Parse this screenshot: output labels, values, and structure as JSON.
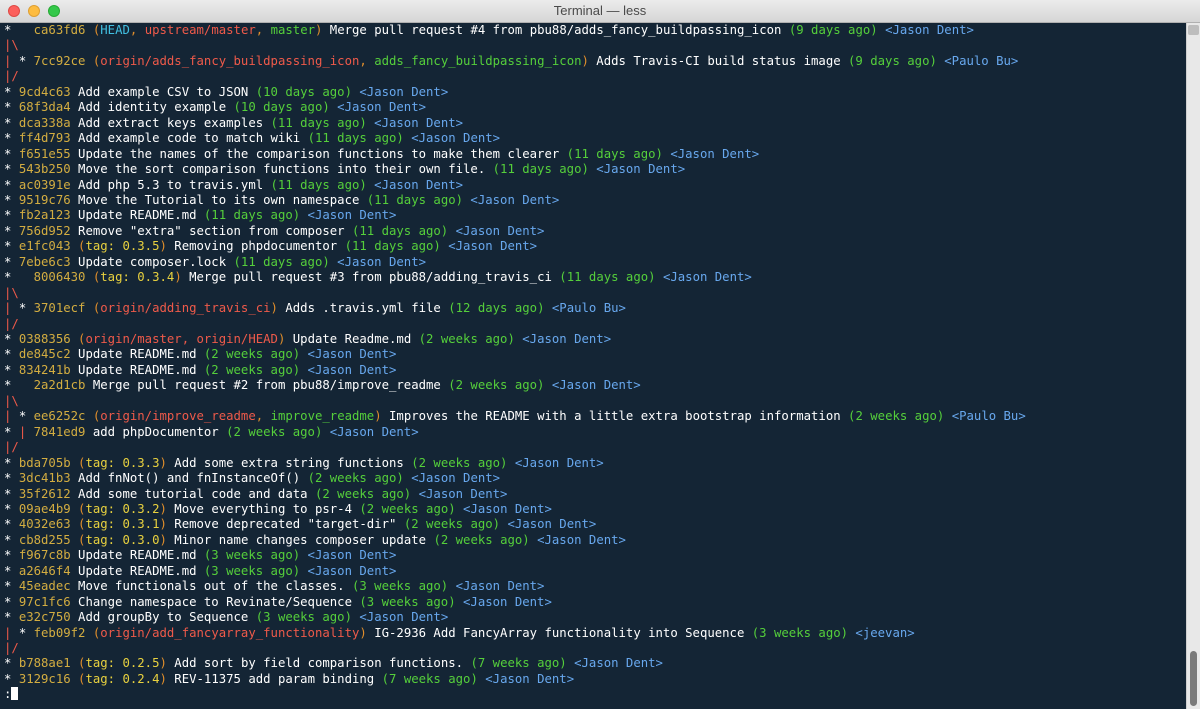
{
  "window": {
    "title": "Terminal — less"
  },
  "colors": {
    "white": "#ffffff",
    "orange": "#e08e2b",
    "gold": "#d3ad41",
    "cyan": "#41bfe0",
    "green": "#55cf3b",
    "blue": "#68a8ee",
    "red": "#ef5a4a",
    "yellow": "#e8d13f",
    "prompt": "#ffffff"
  },
  "prompt": ":",
  "lines": [
    [
      [
        "*",
        "white"
      ],
      [
        "   ",
        "white"
      ],
      [
        "ca63fd6",
        "gold"
      ],
      [
        " (",
        "orange"
      ],
      [
        "HEAD",
        "cyan"
      ],
      [
        ", ",
        "orange"
      ],
      [
        "upstream/master",
        "red"
      ],
      [
        ", ",
        "orange"
      ],
      [
        "master",
        "green"
      ],
      [
        ")",
        "orange"
      ],
      [
        " Merge pull request #4 from pbu88/adds_fancy_buildpassing_icon ",
        "white"
      ],
      [
        "(9 days ago)",
        "green"
      ],
      [
        " <Jason Dent>",
        "blue"
      ]
    ],
    [
      [
        "|\\",
        "red"
      ]
    ],
    [
      [
        "| ",
        "red"
      ],
      [
        "* ",
        "white"
      ],
      [
        "7cc92ce",
        "gold"
      ],
      [
        " (",
        "orange"
      ],
      [
        "origin/adds_fancy_buildpassing_icon",
        "red"
      ],
      [
        ", ",
        "orange"
      ],
      [
        "adds_fancy_buildpassing_icon",
        "green"
      ],
      [
        ")",
        "orange"
      ],
      [
        " Adds Travis-CI build status image ",
        "white"
      ],
      [
        "(9 days ago)",
        "green"
      ],
      [
        " <Paulo Bu>",
        "blue"
      ]
    ],
    [
      [
        "|/",
        "red"
      ]
    ],
    [
      [
        "* ",
        "white"
      ],
      [
        "9cd4c63",
        "gold"
      ],
      [
        " Add example CSV to JSON ",
        "white"
      ],
      [
        "(10 days ago)",
        "green"
      ],
      [
        " <Jason Dent>",
        "blue"
      ]
    ],
    [
      [
        "* ",
        "white"
      ],
      [
        "68f3da4",
        "gold"
      ],
      [
        " Add identity example ",
        "white"
      ],
      [
        "(10 days ago)",
        "green"
      ],
      [
        " <Jason Dent>",
        "blue"
      ]
    ],
    [
      [
        "* ",
        "white"
      ],
      [
        "dca338a",
        "gold"
      ],
      [
        " Add extract keys examples ",
        "white"
      ],
      [
        "(11 days ago)",
        "green"
      ],
      [
        " <Jason Dent>",
        "blue"
      ]
    ],
    [
      [
        "* ",
        "white"
      ],
      [
        "ff4d793",
        "gold"
      ],
      [
        " Add example code to match wiki ",
        "white"
      ],
      [
        "(11 days ago)",
        "green"
      ],
      [
        " <Jason Dent>",
        "blue"
      ]
    ],
    [
      [
        "* ",
        "white"
      ],
      [
        "f651e55",
        "gold"
      ],
      [
        " Update the names of the comparison functions to make them clearer ",
        "white"
      ],
      [
        "(11 days ago)",
        "green"
      ],
      [
        " <Jason Dent>",
        "blue"
      ]
    ],
    [
      [
        "* ",
        "white"
      ],
      [
        "543b250",
        "gold"
      ],
      [
        " Move the sort comparison functions into their own file. ",
        "white"
      ],
      [
        "(11 days ago)",
        "green"
      ],
      [
        " <Jason Dent>",
        "blue"
      ]
    ],
    [
      [
        "* ",
        "white"
      ],
      [
        "ac0391e",
        "gold"
      ],
      [
        " Add php 5.3 to travis.yml ",
        "white"
      ],
      [
        "(11 days ago)",
        "green"
      ],
      [
        " <Jason Dent>",
        "blue"
      ]
    ],
    [
      [
        "* ",
        "white"
      ],
      [
        "9519c76",
        "gold"
      ],
      [
        " Move the Tutorial to its own namespace ",
        "white"
      ],
      [
        "(11 days ago)",
        "green"
      ],
      [
        " <Jason Dent>",
        "blue"
      ]
    ],
    [
      [
        "* ",
        "white"
      ],
      [
        "fb2a123",
        "gold"
      ],
      [
        " Update README.md ",
        "white"
      ],
      [
        "(11 days ago)",
        "green"
      ],
      [
        " <Jason Dent>",
        "blue"
      ]
    ],
    [
      [
        "* ",
        "white"
      ],
      [
        "756d952",
        "gold"
      ],
      [
        " Remove \"extra\" section from composer ",
        "white"
      ],
      [
        "(11 days ago)",
        "green"
      ],
      [
        " <Jason Dent>",
        "blue"
      ]
    ],
    [
      [
        "* ",
        "white"
      ],
      [
        "e1fc043",
        "gold"
      ],
      [
        " (",
        "orange"
      ],
      [
        "tag: 0.3.5",
        "yellow"
      ],
      [
        ")",
        "orange"
      ],
      [
        " Removing phpdocumentor ",
        "white"
      ],
      [
        "(11 days ago)",
        "green"
      ],
      [
        " <Jason Dent>",
        "blue"
      ]
    ],
    [
      [
        "* ",
        "white"
      ],
      [
        "7ebe6c3",
        "gold"
      ],
      [
        " Update composer.lock ",
        "white"
      ],
      [
        "(11 days ago)",
        "green"
      ],
      [
        " <Jason Dent>",
        "blue"
      ]
    ],
    [
      [
        "*",
        "white"
      ],
      [
        "   ",
        "white"
      ],
      [
        "8006430",
        "gold"
      ],
      [
        " (",
        "orange"
      ],
      [
        "tag: 0.3.4",
        "yellow"
      ],
      [
        ")",
        "orange"
      ],
      [
        " Merge pull request #3 from pbu88/adding_travis_ci ",
        "white"
      ],
      [
        "(11 days ago)",
        "green"
      ],
      [
        " <Jason Dent>",
        "blue"
      ]
    ],
    [
      [
        "|\\",
        "red"
      ]
    ],
    [
      [
        "| ",
        "red"
      ],
      [
        "* ",
        "white"
      ],
      [
        "3701ecf",
        "gold"
      ],
      [
        " (",
        "orange"
      ],
      [
        "origin/adding_travis_ci",
        "red"
      ],
      [
        ")",
        "orange"
      ],
      [
        " Adds .travis.yml file ",
        "white"
      ],
      [
        "(12 days ago)",
        "green"
      ],
      [
        " <Paulo Bu>",
        "blue"
      ]
    ],
    [
      [
        "|/",
        "red"
      ]
    ],
    [
      [
        "* ",
        "white"
      ],
      [
        "0388356",
        "gold"
      ],
      [
        " (",
        "orange"
      ],
      [
        "origin/master, origin/HEAD",
        "red"
      ],
      [
        ")",
        "orange"
      ],
      [
        " Update Readme.md ",
        "white"
      ],
      [
        "(2 weeks ago)",
        "green"
      ],
      [
        " <Jason Dent>",
        "blue"
      ]
    ],
    [
      [
        "* ",
        "white"
      ],
      [
        "de845c2",
        "gold"
      ],
      [
        " Update README.md ",
        "white"
      ],
      [
        "(2 weeks ago)",
        "green"
      ],
      [
        " <Jason Dent>",
        "blue"
      ]
    ],
    [
      [
        "* ",
        "white"
      ],
      [
        "834241b",
        "gold"
      ],
      [
        " Update README.md ",
        "white"
      ],
      [
        "(2 weeks ago)",
        "green"
      ],
      [
        " <Jason Dent>",
        "blue"
      ]
    ],
    [
      [
        "*",
        "white"
      ],
      [
        "   ",
        "white"
      ],
      [
        "2a2d1cb",
        "gold"
      ],
      [
        " Merge pull request #2 from pbu88/improve_readme ",
        "white"
      ],
      [
        "(2 weeks ago)",
        "green"
      ],
      [
        " <Jason Dent>",
        "blue"
      ]
    ],
    [
      [
        "|\\",
        "red"
      ]
    ],
    [
      [
        "| ",
        "red"
      ],
      [
        "* ",
        "white"
      ],
      [
        "ee6252c",
        "gold"
      ],
      [
        " (",
        "orange"
      ],
      [
        "origin/improve_readme",
        "red"
      ],
      [
        ", ",
        "orange"
      ],
      [
        "improve_readme",
        "green"
      ],
      [
        ")",
        "orange"
      ],
      [
        " Improves the README with a little extra bootstrap information ",
        "white"
      ],
      [
        "(2 weeks ago)",
        "green"
      ],
      [
        " <Paulo Bu>",
        "blue"
      ]
    ],
    [
      [
        "* ",
        "white"
      ],
      [
        "| ",
        "red"
      ],
      [
        "7841ed9",
        "gold"
      ],
      [
        " add phpDocumentor ",
        "white"
      ],
      [
        "(2 weeks ago)",
        "green"
      ],
      [
        " <Jason Dent>",
        "blue"
      ]
    ],
    [
      [
        "|/",
        "red"
      ]
    ],
    [
      [
        "* ",
        "white"
      ],
      [
        "bda705b",
        "gold"
      ],
      [
        " (",
        "orange"
      ],
      [
        "tag: 0.3.3",
        "yellow"
      ],
      [
        ")",
        "orange"
      ],
      [
        " Add some extra string functions ",
        "white"
      ],
      [
        "(2 weeks ago)",
        "green"
      ],
      [
        " <Jason Dent>",
        "blue"
      ]
    ],
    [
      [
        "* ",
        "white"
      ],
      [
        "3dc41b3",
        "gold"
      ],
      [
        " Add fnNot() and fnInstanceOf() ",
        "white"
      ],
      [
        "(2 weeks ago)",
        "green"
      ],
      [
        " <Jason Dent>",
        "blue"
      ]
    ],
    [
      [
        "* ",
        "white"
      ],
      [
        "35f2612",
        "gold"
      ],
      [
        " Add some tutorial code and data ",
        "white"
      ],
      [
        "(2 weeks ago)",
        "green"
      ],
      [
        " <Jason Dent>",
        "blue"
      ]
    ],
    [
      [
        "* ",
        "white"
      ],
      [
        "09ae4b9",
        "gold"
      ],
      [
        " (",
        "orange"
      ],
      [
        "tag: 0.3.2",
        "yellow"
      ],
      [
        ")",
        "orange"
      ],
      [
        " Move everything to psr-4 ",
        "white"
      ],
      [
        "(2 weeks ago)",
        "green"
      ],
      [
        " <Jason Dent>",
        "blue"
      ]
    ],
    [
      [
        "* ",
        "white"
      ],
      [
        "4032e63",
        "gold"
      ],
      [
        " (",
        "orange"
      ],
      [
        "tag: 0.3.1",
        "yellow"
      ],
      [
        ")",
        "orange"
      ],
      [
        " Remove deprecated \"target-dir\" ",
        "white"
      ],
      [
        "(2 weeks ago)",
        "green"
      ],
      [
        " <Jason Dent>",
        "blue"
      ]
    ],
    [
      [
        "* ",
        "white"
      ],
      [
        "cb8d255",
        "gold"
      ],
      [
        " (",
        "orange"
      ],
      [
        "tag: 0.3.0",
        "yellow"
      ],
      [
        ")",
        "orange"
      ],
      [
        " Minor name changes composer update ",
        "white"
      ],
      [
        "(2 weeks ago)",
        "green"
      ],
      [
        " <Jason Dent>",
        "blue"
      ]
    ],
    [
      [
        "* ",
        "white"
      ],
      [
        "f967c8b",
        "gold"
      ],
      [
        " Update README.md ",
        "white"
      ],
      [
        "(3 weeks ago)",
        "green"
      ],
      [
        " <Jason Dent>",
        "blue"
      ]
    ],
    [
      [
        "* ",
        "white"
      ],
      [
        "a2646f4",
        "gold"
      ],
      [
        " Update README.md ",
        "white"
      ],
      [
        "(3 weeks ago)",
        "green"
      ],
      [
        " <Jason Dent>",
        "blue"
      ]
    ],
    [
      [
        "* ",
        "white"
      ],
      [
        "45eadec",
        "gold"
      ],
      [
        " Move functionals out of the classes. ",
        "white"
      ],
      [
        "(3 weeks ago)",
        "green"
      ],
      [
        " <Jason Dent>",
        "blue"
      ]
    ],
    [
      [
        "* ",
        "white"
      ],
      [
        "97c1fc6",
        "gold"
      ],
      [
        " Change namespace to Revinate/Sequence ",
        "white"
      ],
      [
        "(3 weeks ago)",
        "green"
      ],
      [
        " <Jason Dent>",
        "blue"
      ]
    ],
    [
      [
        "* ",
        "white"
      ],
      [
        "e32c750",
        "gold"
      ],
      [
        " Add groupBy to Sequence ",
        "white"
      ],
      [
        "(3 weeks ago)",
        "green"
      ],
      [
        " <Jason Dent>",
        "blue"
      ]
    ],
    [
      [
        "| ",
        "red"
      ],
      [
        "* ",
        "white"
      ],
      [
        "feb09f2",
        "gold"
      ],
      [
        " (",
        "orange"
      ],
      [
        "origin/add_fancyarray_functionality",
        "red"
      ],
      [
        ")",
        "orange"
      ],
      [
        " IG-2936 Add FancyArray functionality into Sequence ",
        "white"
      ],
      [
        "(3 weeks ago)",
        "green"
      ],
      [
        " <jeevan>",
        "blue"
      ]
    ],
    [
      [
        "|/",
        "red"
      ]
    ],
    [
      [
        "* ",
        "white"
      ],
      [
        "b788ae1",
        "gold"
      ],
      [
        " (",
        "orange"
      ],
      [
        "tag: 0.2.5",
        "yellow"
      ],
      [
        ")",
        "orange"
      ],
      [
        " Add sort by field comparison functions. ",
        "white"
      ],
      [
        "(7 weeks ago)",
        "green"
      ],
      [
        " <Jason Dent>",
        "blue"
      ]
    ],
    [
      [
        "* ",
        "white"
      ],
      [
        "3129c16",
        "gold"
      ],
      [
        " (",
        "orange"
      ],
      [
        "tag: 0.2.4",
        "yellow"
      ],
      [
        ")",
        "orange"
      ],
      [
        " REV-11375 add param binding ",
        "white"
      ],
      [
        "(7 weeks ago)",
        "green"
      ],
      [
        " <Jason Dent>",
        "blue"
      ]
    ]
  ]
}
